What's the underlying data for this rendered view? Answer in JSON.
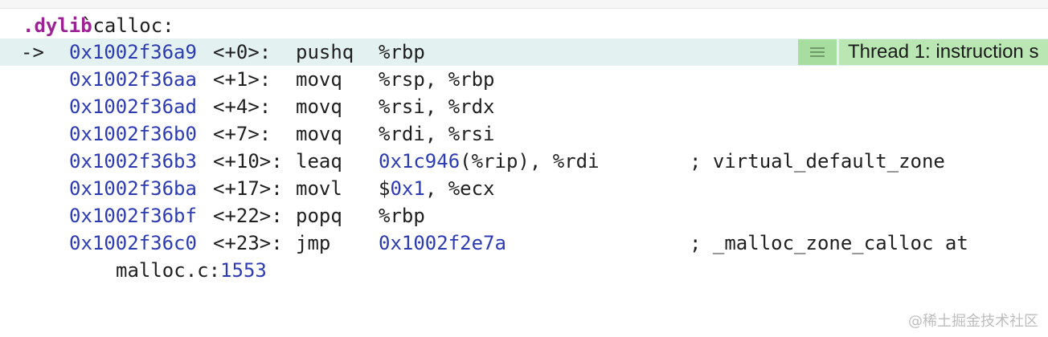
{
  "symbol": {
    "prefix": ".dylib",
    "name": "`calloc:"
  },
  "pc_arrow": "->",
  "thread_badge": {
    "icon": "lines-icon",
    "label": "Thread 1: instruction s"
  },
  "instructions": [
    {
      "address": "0x1002f36a9",
      "offset": "<+0>:",
      "mnemonic": "pushq",
      "operands": "%rbp",
      "comment": ""
    },
    {
      "address": "0x1002f36aa",
      "offset": "<+1>:",
      "mnemonic": "movq",
      "operands": "%rsp, %rbp",
      "comment": ""
    },
    {
      "address": "0x1002f36ad",
      "offset": "<+4>:",
      "mnemonic": "movq",
      "operands": "%rsi, %rdx",
      "comment": ""
    },
    {
      "address": "0x1002f36b0",
      "offset": "<+7>:",
      "mnemonic": "movq",
      "operands": "%rdi, %rsi",
      "comment": ""
    },
    {
      "address": "0x1002f36b3",
      "offset": "<+10>:",
      "mnemonic": "leaq",
      "operand_literal": "0x1c946",
      "operands_rest": "(%rip), %rdi",
      "comment": "; virtual_default_zone"
    },
    {
      "address": "0x1002f36ba",
      "offset": "<+17>:",
      "mnemonic": "movl",
      "operand_prefix": "$",
      "operand_literal": "0x1",
      "operands_rest": ", %ecx",
      "comment": ""
    },
    {
      "address": "0x1002f36bf",
      "offset": "<+22>:",
      "mnemonic": "popq",
      "operands": "%rbp",
      "comment": ""
    },
    {
      "address": "0x1002f36c0",
      "offset": "<+23>:",
      "mnemonic": "jmp",
      "operand_literal": "0x1002f2e7a",
      "comment": "; _malloc_zone_calloc at"
    }
  ],
  "continuation": {
    "file": "malloc.c:",
    "line": "1553"
  },
  "watermark": "@稀土掘金技术社区",
  "colors": {
    "address": "#2c3bb3",
    "keyword": "#9b2393",
    "pc_highlight": "#e3f1f0",
    "thread_badge": "#b9e6b2"
  }
}
